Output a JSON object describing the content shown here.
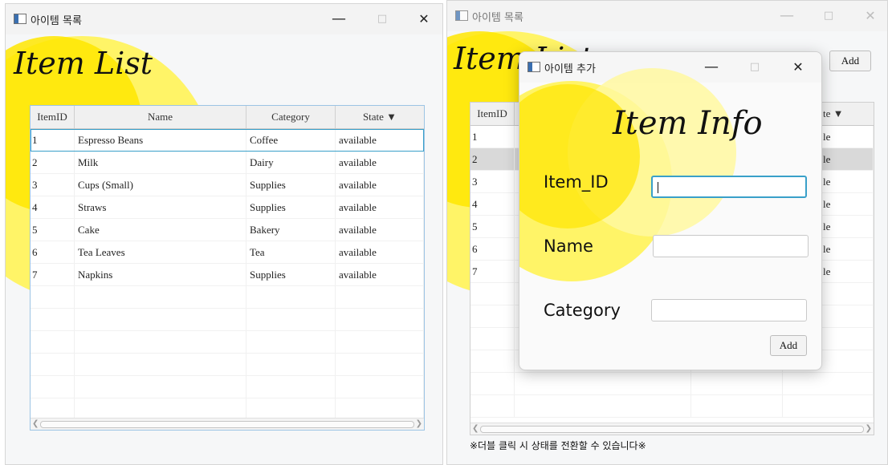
{
  "main_window": {
    "title": "아이템 목록",
    "heading": "Item List",
    "columns": [
      "ItemID",
      "Name",
      "Category",
      "State ▼"
    ],
    "rows": [
      [
        "1",
        "Espresso Beans",
        "Coffee",
        "available"
      ],
      [
        "2",
        "Milk",
        "Dairy",
        "available"
      ],
      [
        "3",
        "Cups (Small)",
        "Supplies",
        "available"
      ],
      [
        "4",
        "Straws",
        "Supplies",
        "available"
      ],
      [
        "5",
        "Cake",
        "Bakery",
        "available"
      ],
      [
        "6",
        "Tea Leaves",
        "Tea",
        "available"
      ],
      [
        "7",
        "Napkins",
        "Supplies",
        "available"
      ]
    ]
  },
  "back_window": {
    "title": "아이템 목록",
    "heading": "Item List",
    "add_button": "Add",
    "columns": [
      "ItemID",
      "te ▼"
    ],
    "row_ids": [
      "1",
      "2",
      "3",
      "4",
      "5",
      "6",
      "7"
    ],
    "state_fragment": "le",
    "hint": "※더블 클릭 시 상태를 전환할 수 있습니다※"
  },
  "dialog": {
    "title": "아이템 추가",
    "heading": "Item Info",
    "fields": [
      {
        "label": "Item_ID",
        "value": ""
      },
      {
        "label": "Name",
        "value": ""
      },
      {
        "label": "Category",
        "value": ""
      }
    ],
    "add_button": "Add"
  },
  "colors": {
    "accent_yellow": "#fff200",
    "pale_yellow": "#fff590",
    "focus_blue": "#39a0c9",
    "selected_row": "#d9d9d9"
  },
  "window_controls": {
    "minimize": "—",
    "maximize": "□",
    "close": "✕"
  }
}
